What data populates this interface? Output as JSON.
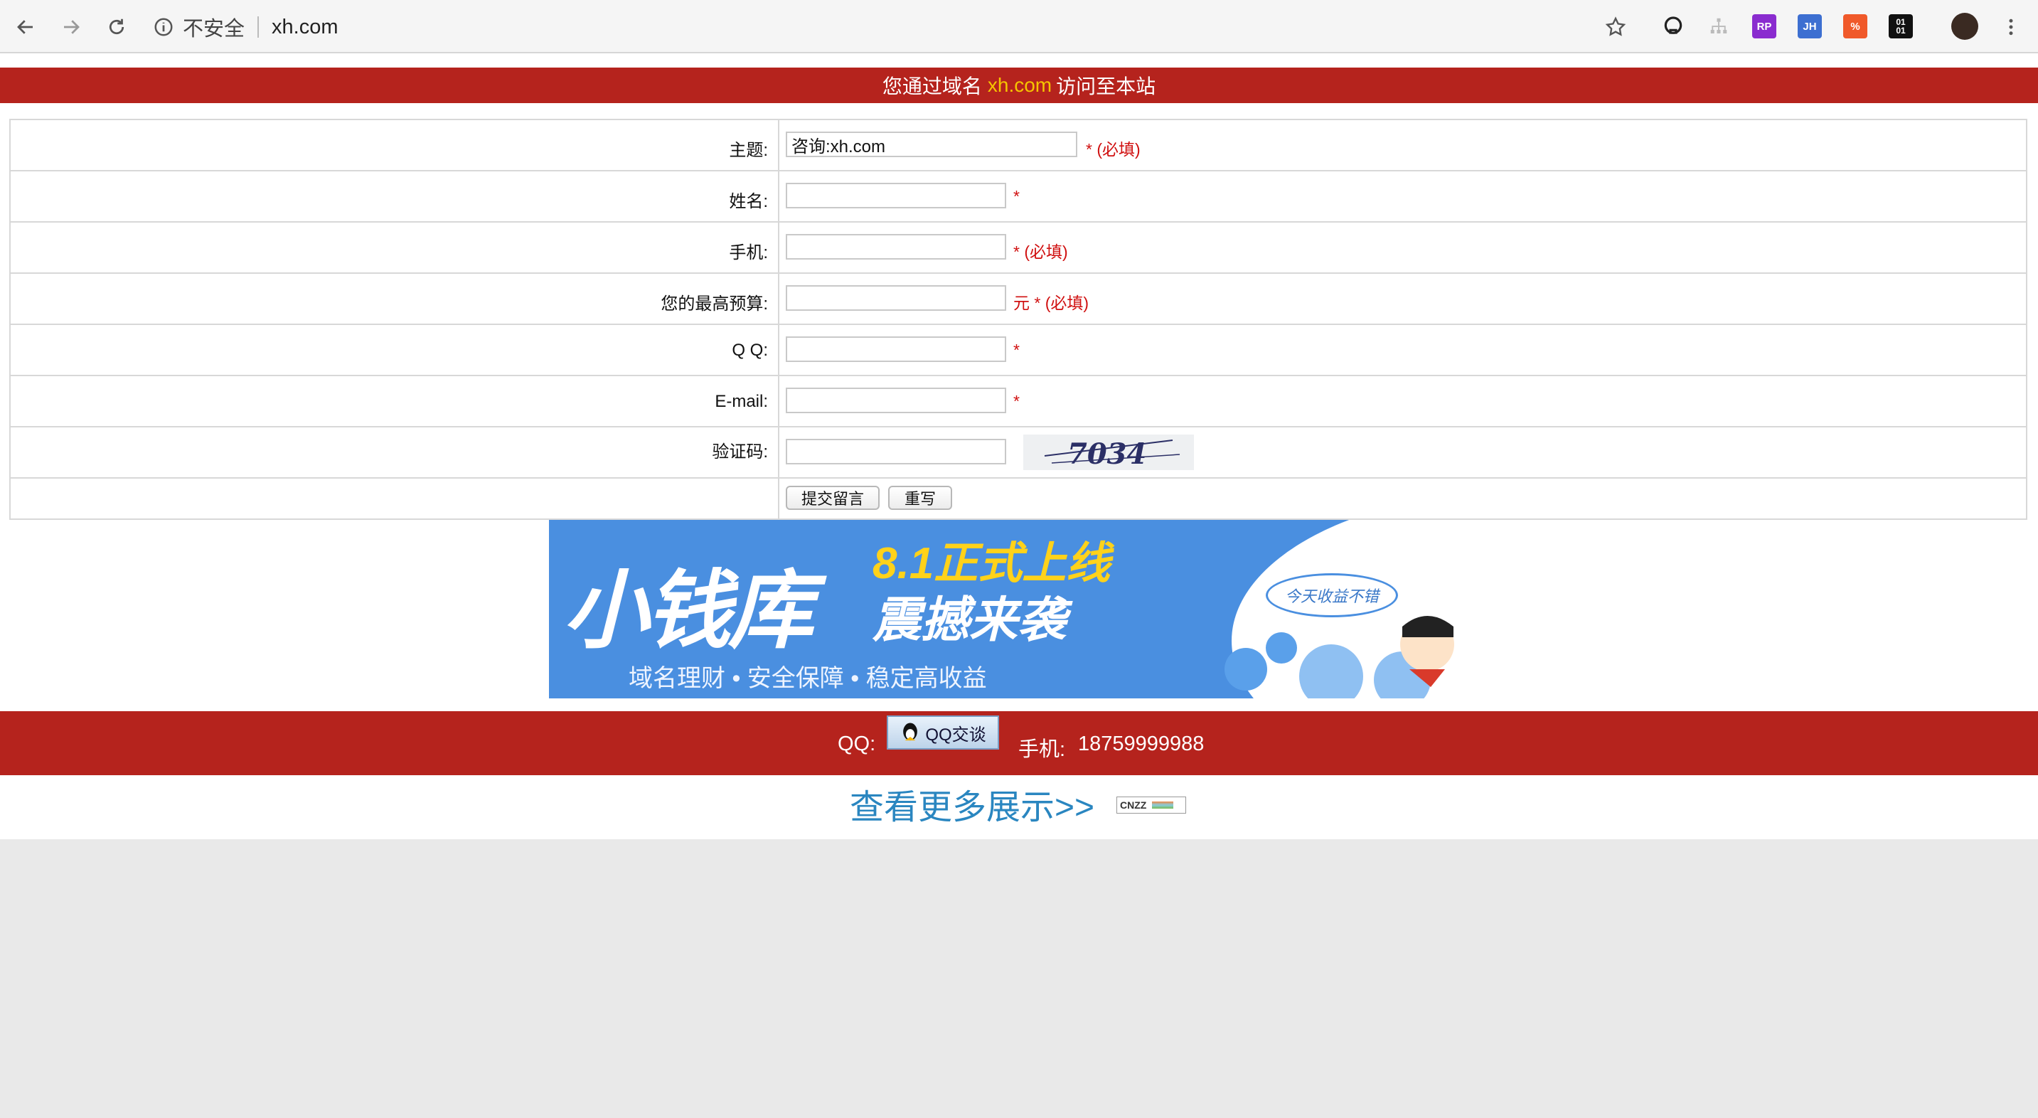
{
  "browser": {
    "security_label": "不安全",
    "url": "xh.com"
  },
  "header": {
    "prefix": "您通过域名",
    "domain": "xh.com",
    "suffix": "访问至本站"
  },
  "form": {
    "subject_label": "主题:",
    "subject_value": "咨询:xh.com",
    "subject_note": "* (必填)",
    "name_label": "姓名:",
    "name_note": "*",
    "phone_label": "手机:",
    "phone_note": "* (必填)",
    "budget_label": "您的最高预算:",
    "budget_note": "元 * (必填)",
    "qq_label": "Q Q:",
    "qq_note": "*",
    "email_label": "E-mail:",
    "email_note": "*",
    "captcha_label": "验证码:",
    "captcha_text": "7034",
    "submit_label": "提交留言",
    "reset_label": "重写"
  },
  "banner": {
    "brand": "小钱库",
    "promo_line1": "8.1正式上线",
    "promo_line2": "震撼来袭",
    "slogan": "域名理财 • 安全保障 • 稳定高收益",
    "bubble": "今天收益不错"
  },
  "footer": {
    "qq_label": "QQ:",
    "qq_button": "QQ交谈",
    "phone_label": "手机:",
    "phone_value": "18759999988",
    "more_link": "查看更多展示>>",
    "cnzz_badge": "CNZZ"
  }
}
